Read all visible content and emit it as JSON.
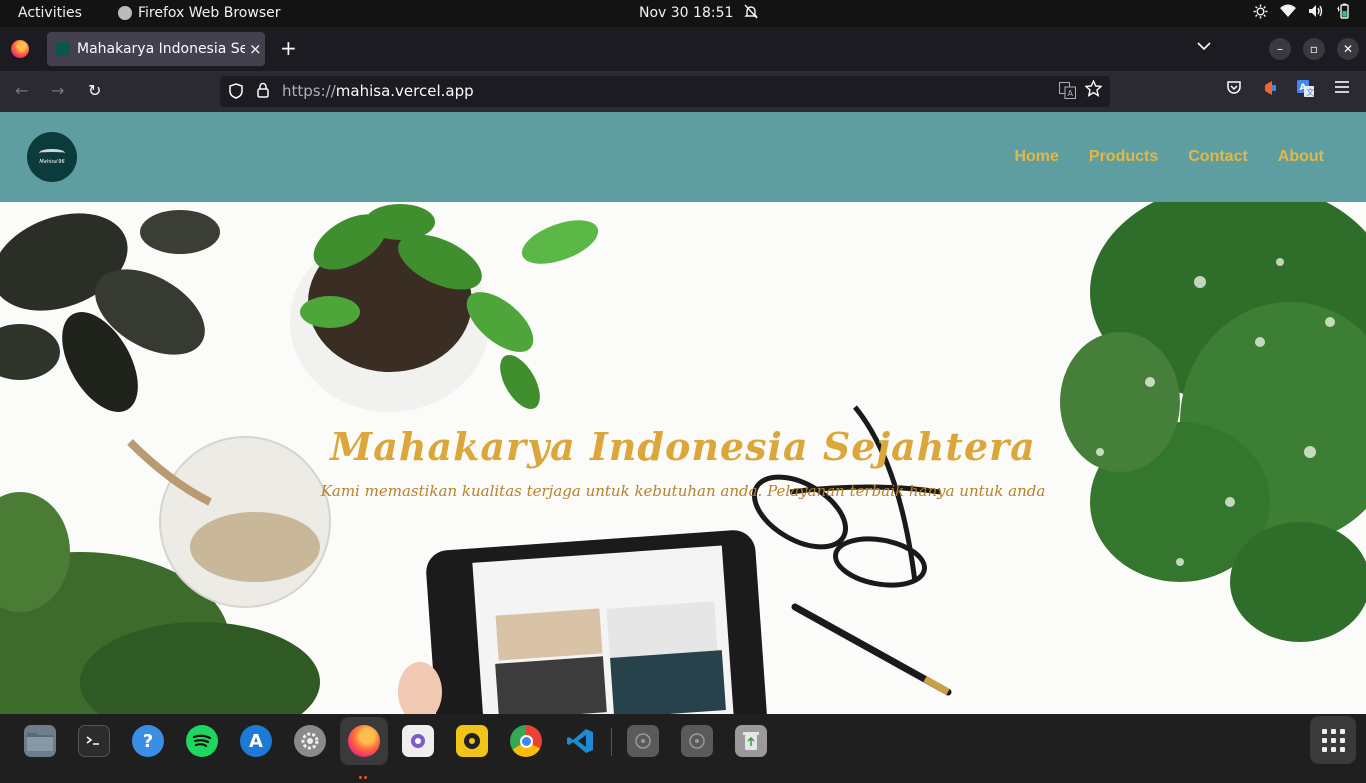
{
  "system_bar": {
    "activities": "Activities",
    "app_name": "Firefox Web Browser",
    "clock": "Nov 30  18:51",
    "tray_icons": [
      "notifications-off-icon",
      "brightness-icon",
      "wifi-icon",
      "volume-icon",
      "battery-icon"
    ]
  },
  "browser": {
    "tab_title": "Mahakarya Indonesia Sejahtera",
    "tab_close": "×",
    "new_tab": "+",
    "list_tabs": "⌄",
    "window_controls": {
      "minimize": "–",
      "restore": "▫",
      "close": "✕"
    },
    "back": "←",
    "forward": "→",
    "reload": "↻",
    "url_protocol": "https://",
    "url_host": "mahisa.vercel.app",
    "toolbar_icons": [
      "pocket-icon",
      "extension-icon",
      "translate-extension-icon",
      "menu-icon"
    ]
  },
  "site": {
    "logo_text": "Mahisa'96",
    "nav": [
      {
        "label": "Home"
      },
      {
        "label": "Products"
      },
      {
        "label": "Contact"
      },
      {
        "label": "About"
      }
    ],
    "hero_title": "Mahakarya Indonesia Sejahtera",
    "hero_subtitle": "Kami memastikan kualitas terjaga untuk kebutuhan anda. Pelayanan terbaik hanya untuk anda",
    "colors": {
      "header_bg": "#5f9ea0",
      "nav_text": "#e0b84a",
      "title": "#dba63a",
      "subtitle": "#b9812a"
    }
  },
  "dock": {
    "apps": [
      "files-icon",
      "terminal-icon",
      "help-icon",
      "spotify-icon",
      "app-center-icon",
      "settings-icon",
      "firefox-icon",
      "screenshot-icon",
      "rhythmbox-icon",
      "chrome-icon",
      "vscode-icon",
      "disk-icon",
      "disk-icon-2",
      "trash-icon"
    ],
    "show_apps": "show-apps-icon"
  }
}
